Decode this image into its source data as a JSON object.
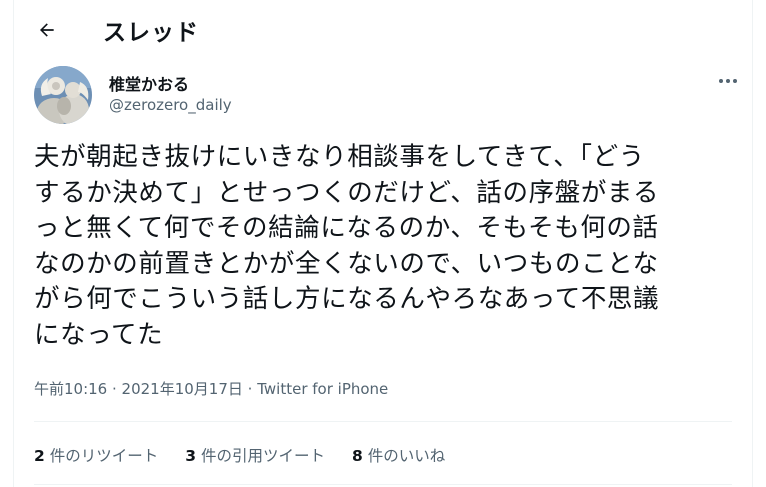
{
  "header": {
    "title": "スレッド",
    "back_icon": "arrow-left-icon"
  },
  "author": {
    "name": "椎堂かおる",
    "handle": "@zerozero_daily",
    "avatar_icon": "statue-avatar"
  },
  "menu": {
    "icon": "more-horizontal-icon"
  },
  "tweet": {
    "text": "夫が朝起き抜けにいきなり相談事をしてきて、「どう\nするか決めて」とせっつくのだけど、話の序盤がまる\nっと無くて何でその結論になるのか、そもそも何の話\nなのかの前置きとかが全くないので、いつものことな\nがら何でこういう話し方になるんやろなあって不思議\nになってた"
  },
  "meta": {
    "time": "午前10:16",
    "separator1": " · ",
    "date": "2021年10月17日",
    "separator2": " · ",
    "source": "Twitter for iPhone"
  },
  "stats": {
    "retweets": {
      "count": "2",
      "label": "件のリツイート"
    },
    "quotes": {
      "count": "3",
      "label": "件の引用ツイート"
    },
    "likes": {
      "count": "8",
      "label": "件のいいね"
    }
  },
  "colors": {
    "text": "#0f1419",
    "secondary": "#536471",
    "border": "#eff3f4"
  }
}
